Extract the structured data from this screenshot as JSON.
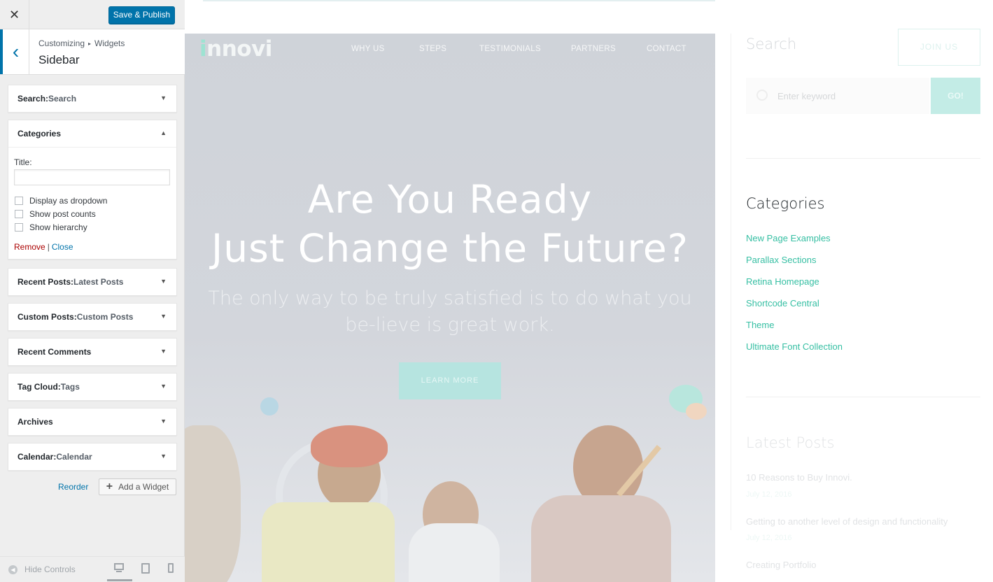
{
  "header": {
    "close_glyph": "✕",
    "publish_label": "Save & Publish"
  },
  "section": {
    "back_glyph": "‹",
    "breadcrumb_root": "Customizing",
    "breadcrumb_sep": "▸",
    "breadcrumb_leaf": "Widgets",
    "title": "Sidebar"
  },
  "widgets": [
    {
      "name": "Search",
      "sep": ":",
      "sub": " Search",
      "arrow": "▼"
    },
    {
      "name": "Categories",
      "sep": "",
      "sub": "",
      "arrow": "▲"
    },
    {
      "name": "Recent Posts",
      "sep": ":",
      "sub": " Latest Posts",
      "arrow": "▼"
    },
    {
      "name": "Custom Posts",
      "sep": ":",
      "sub": " Custom Posts",
      "arrow": "▼"
    },
    {
      "name": "Recent Comments",
      "sep": "",
      "sub": "",
      "arrow": "▼"
    },
    {
      "name": "Tag Cloud",
      "sep": ":",
      "sub": " Tags",
      "arrow": "▼"
    },
    {
      "name": "Archives",
      "sep": "",
      "sub": "",
      "arrow": "▼"
    },
    {
      "name": "Calendar",
      "sep": ":",
      "sub": " Calendar",
      "arrow": "▼"
    }
  ],
  "categories_form": {
    "title_label": "Title:",
    "title_value": "",
    "options": [
      "Display as dropdown",
      "Show post counts",
      "Show hierarchy"
    ],
    "remove_label": "Remove",
    "separator": "|",
    "close_label": "Close"
  },
  "actions": {
    "reorder_label": "Reorder",
    "add_plus": "+",
    "add_label": "Add a Widget"
  },
  "footer": {
    "hide_label": "Hide Controls",
    "hide_glyph": "◀"
  },
  "site": {
    "logo_initial": "i",
    "logo_rest": "nnovi",
    "nav": [
      "WHY US",
      "STEPS",
      "TESTIMONIALS",
      "PARTNERS",
      "CONTACT"
    ],
    "hero_line1": "Are You Ready",
    "hero_line2": "Just Change the Future?",
    "hero_sub": "The only way to be truly satisfied is to do what you be-lieve is great work.",
    "learn_more": "LEARN MORE"
  },
  "sidebar": {
    "search_title": "Search",
    "join_label": "JOIN US",
    "search_placeholder": "Enter keyword",
    "go_label": "GO!",
    "categories_title": "Categories",
    "categories": [
      "New Page Examples",
      "Parallax Sections",
      "Retina Homepage",
      "Shortcode Central",
      "Theme",
      "Ultimate Font Collection"
    ],
    "latest_title": "Latest Posts",
    "posts": [
      {
        "title": "10 Reasons to Buy Innovi.",
        "date": "July 12, 2016"
      },
      {
        "title": "Getting to another level of design and functionality",
        "date": "July 12, 2016"
      },
      {
        "title": "Creating Portfolio",
        "date": ""
      }
    ]
  },
  "colors": {
    "accent": "#0073aa",
    "teal": "#36bfa3",
    "remove": "#aa0000"
  }
}
